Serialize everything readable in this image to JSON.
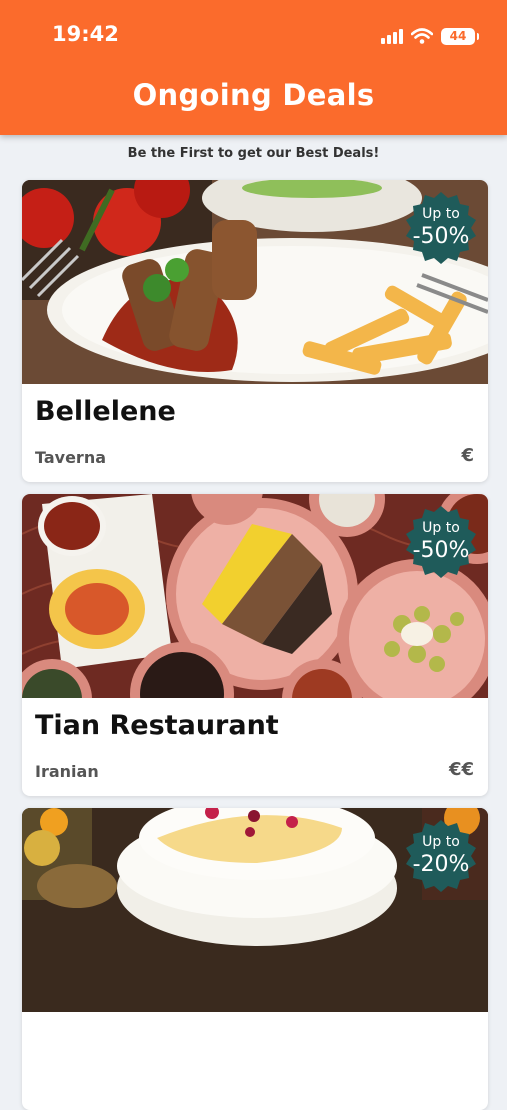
{
  "status": {
    "time": "19:42",
    "battery": "44"
  },
  "header": {
    "title": "Ongoing Deals"
  },
  "subtitle": "Be the First to get our Best Deals!",
  "deals": [
    {
      "name": "Bellelene",
      "category": "Taverna",
      "price": "€",
      "badge_prefix": "Up to",
      "discount": "-50%"
    },
    {
      "name": "Tian Restaurant",
      "category": "Iranian",
      "price": "€€",
      "badge_prefix": "Up to",
      "discount": "-50%"
    },
    {
      "name": "",
      "category": "",
      "price": "",
      "badge_prefix": "Up to",
      "discount": "-20%"
    }
  ],
  "colors": {
    "accent": "#fb6b2c",
    "badge": "#1f5b5a",
    "background": "#eef1f5"
  },
  "icons": [
    "signal-icon",
    "wifi-icon",
    "battery-icon"
  ]
}
